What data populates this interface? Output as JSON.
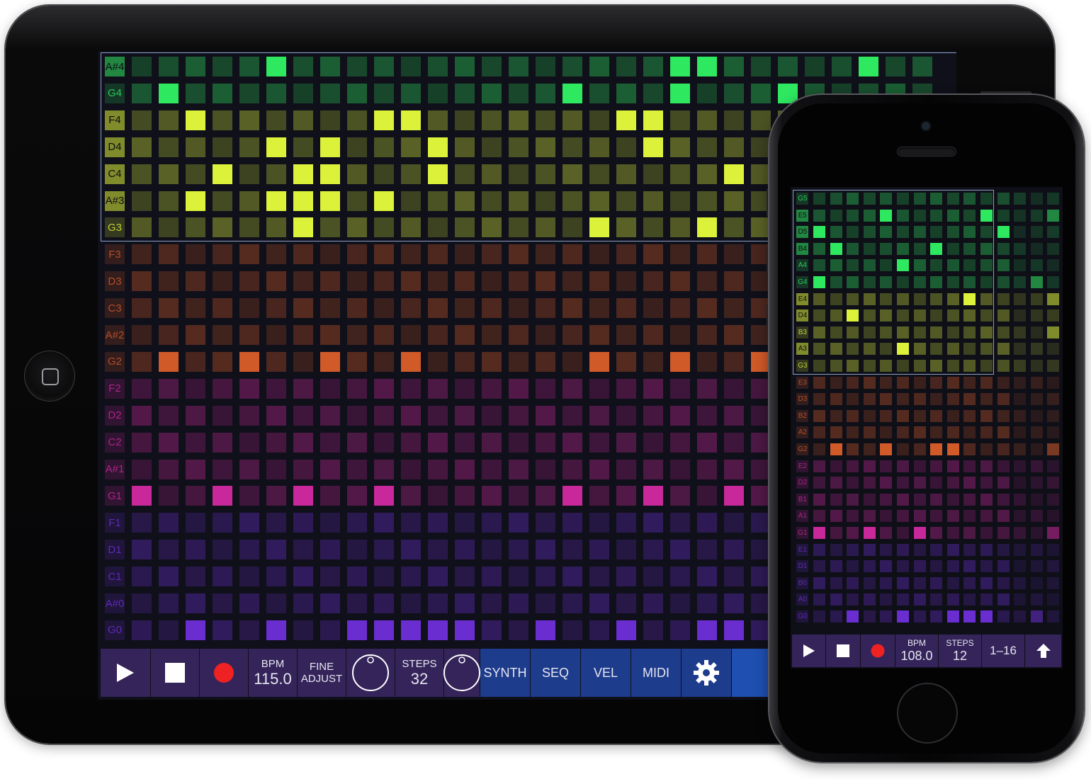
{
  "ipad": {
    "notes": [
      "A#4",
      "G4",
      "F4",
      "D4",
      "C4",
      "A#3",
      "G3",
      "F3",
      "D3",
      "C3",
      "A#2",
      "G2",
      "F2",
      "D2",
      "C2",
      "A#1",
      "G1",
      "F1",
      "D1",
      "C1",
      "A#0",
      "G0"
    ],
    "highlight_notes": [
      "A#4",
      "F4",
      "D4",
      "C4",
      "A#3"
    ],
    "steps_visible": 32,
    "active_cells": {
      "A#4": [
        5,
        20,
        21,
        27
      ],
      "G4": [
        1,
        16,
        20,
        24
      ],
      "F4": [
        2,
        9,
        10,
        18,
        19
      ],
      "D4": [
        5,
        7,
        11,
        19
      ],
      "C4": [
        3,
        6,
        7,
        11,
        22
      ],
      "A#3": [
        2,
        5,
        6,
        7,
        9
      ],
      "G3": [
        6,
        17,
        21
      ],
      "G2": [
        1,
        4,
        7,
        10,
        17,
        20,
        23
      ],
      "G1": [
        0,
        3,
        6,
        9,
        16,
        19,
        22
      ],
      "G0": [
        2,
        5,
        8,
        9,
        10,
        11,
        12,
        15,
        18,
        21,
        22
      ]
    },
    "toolbar": {
      "play_icon": "play-icon",
      "stop_icon": "stop-icon",
      "record_icon": "record-icon",
      "bpm_label": "BPM",
      "bpm_value": "115.0",
      "fine_label_1": "FINE",
      "fine_label_2": "ADJUST",
      "steps_label": "STEPS",
      "steps_value": "32",
      "synth": "SYNTH",
      "seq": "SEQ",
      "vel": "VEL",
      "midi": "MIDI",
      "settings_icon": "gear-icon"
    }
  },
  "iphone": {
    "notes": [
      "G5",
      "E5",
      "D5",
      "B4",
      "A4",
      "G4",
      "E4",
      "D4",
      "B3",
      "A3",
      "G3",
      "E3",
      "D3",
      "B2",
      "A2",
      "G2",
      "E2",
      "D2",
      "B1",
      "A1",
      "G1",
      "E1",
      "D1",
      "B0",
      "A0",
      "G0"
    ],
    "highlight_notes": [
      "E5",
      "D5",
      "B4",
      "E4",
      "D4",
      "A3"
    ],
    "active_cells": {
      "E5": [
        4,
        10,
        14
      ],
      "D5": [
        0,
        11
      ],
      "B4": [
        1,
        7
      ],
      "A4": [
        5
      ],
      "G4": [
        0,
        13
      ],
      "E4": [
        9,
        14
      ],
      "D4": [
        2
      ],
      "B3": [
        14
      ],
      "A3": [
        5
      ],
      "G2": [
        1,
        4,
        7,
        8,
        14
      ],
      "G1": [
        0,
        3,
        6,
        14
      ],
      "G0": [
        2,
        5,
        8,
        9,
        10,
        13
      ]
    },
    "toolbar": {
      "play_icon": "play-icon",
      "stop_icon": "stop-icon",
      "record_icon": "record-icon",
      "bpm_label": "BPM",
      "bpm_value": "108.0",
      "steps_label": "STEPS",
      "steps_value": "12",
      "range": "1–16",
      "up_icon": "arrow-up-icon"
    }
  },
  "colors": {
    "green": "#2ee860",
    "yellow": "#dcf23a",
    "orange": "#d05a28",
    "magenta": "#c8289a",
    "violet": "#6a2ed0",
    "toolbar_purple": "#34245a",
    "toolbar_blue": "#1e3c8c"
  }
}
